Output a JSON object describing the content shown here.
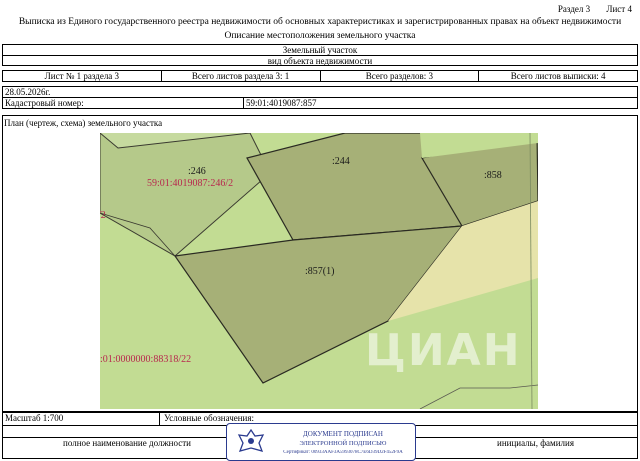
{
  "header": {
    "section": "Раздел 3",
    "sheet": "Лист 4"
  },
  "title": {
    "line1": "Выписка из Единого государственного реестра недвижимости об основных характеристиках и зарегистрированных правах на объект недвижимости",
    "line2": "Описание местоположения земельного участка"
  },
  "object": {
    "name": "Земельный участок",
    "caption": "вид объекта недвижимости"
  },
  "sheets": {
    "sheet_no": "Лист № 1 раздела 3",
    "total_section": "Всего листов раздела 3: 1",
    "total_sections": "Всего разделов: 3",
    "total_extract": "Всего листов выписки: 4"
  },
  "date": "28.05.2026г.",
  "cadastral": {
    "label": "Кадастровый номер:",
    "value": "59:01:4019087:857"
  },
  "plan": {
    "label": "План (чертеж, схема) земельного участка",
    "parcels": [
      ":246",
      ":244",
      ":858",
      ":857(1)"
    ],
    "red_labels": [
      "59:01:4019087:246/2",
      "/2",
      ":01:0000000:88318/22"
    ],
    "watermark": "ЦИАН"
  },
  "footer": {
    "scale": "Масштаб 1:700",
    "legend": "Условные обозначения:",
    "position": "полное наименование должности",
    "name": "инициалы, фамилия"
  },
  "stamp": {
    "line1": "ДОКУМЕНТ ПОДПИСАН",
    "line2": "ЭЛЕКТРОННОЙ ПОДПИСЬЮ",
    "line3": "Сертификат: 00933AAF3A5993078C7E6D39D2F452F9A"
  },
  "colors": {
    "selected_parcel": "#a6b077",
    "neighbor_parcel": "#b5c98a",
    "light_green": "#c2dc93",
    "road": "#e6e3aa",
    "boundary": "#2a2a22",
    "cadastral_red": "#b8284e"
  }
}
